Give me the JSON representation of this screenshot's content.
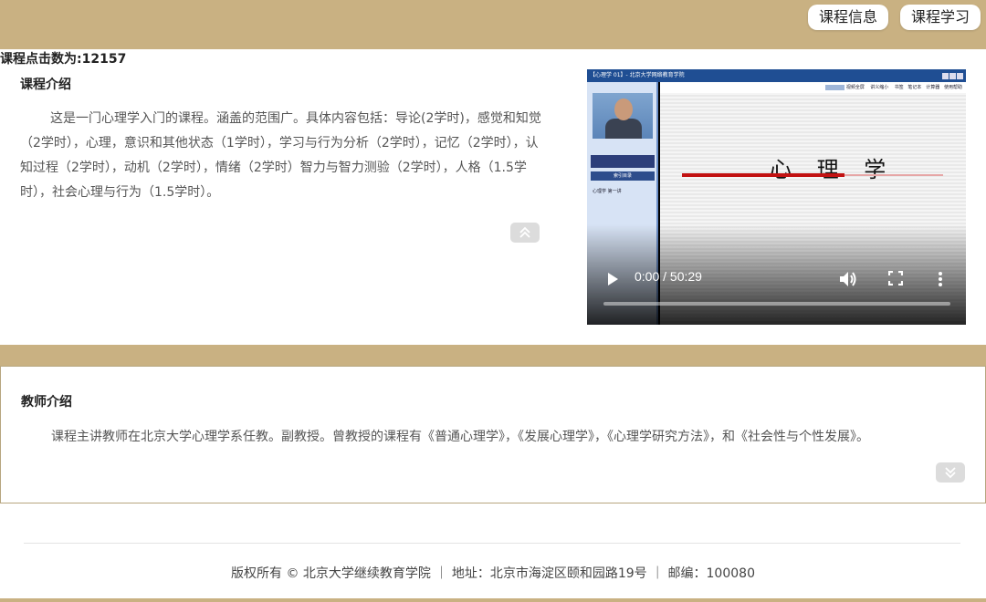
{
  "top_nav": {
    "course_info_label": "课程信息",
    "course_study_label": "课程学习"
  },
  "course_intro": {
    "title": "课程介绍",
    "click_count": "课程点击数为:12157",
    "text": "这是一门心理学入门的课程。涵盖的范围广。具体内容包括：导论(2学时)，感觉和知觉（2学时），心理，意识和其他状态（1学时），学习与行为分析（2学时），记忆（2学时），认知过程（2学时），动机（2学时），情绪（2学时）智力与智力测验（2学时），人格（1.5学时），社会心理与行为（1.5学时）。"
  },
  "video": {
    "window_title": "【心理学 01】- 北京大学网络教育学院",
    "toolbar_items": [
      "视频全屏",
      "讲义缩小",
      "书签",
      "笔记本",
      "计算器",
      "使用帮助"
    ],
    "menu_header": "索引目录",
    "menu_item": "心理学 第一讲",
    "slide_heading": "心 理 学",
    "time": "0:00 / 50:29"
  },
  "teacher_intro": {
    "title": "教师介绍",
    "text": "课程主讲教师在北京大学心理学系任教。副教授。曾教授的课程有《普通心理学》，《发展心理学》，《心理学研究方法》，和《社会性与个性发展》。"
  },
  "footer": {
    "text": "版权所有 © 北京大学继续教育学院 ｜ 地址：北京市海淀区颐和园路19号 ｜ 邮编：100080"
  },
  "colors": {
    "accent": "#c9b182",
    "video_titlebar": "#1f4e93",
    "slide_red": "#c21212"
  },
  "icons": {
    "collapse": "chevron-double-up-icon",
    "expand": "chevron-double-down-icon",
    "play": "play-icon",
    "volume": "volume-icon",
    "fullscreen": "fullscreen-icon",
    "more": "more-vertical-icon"
  }
}
